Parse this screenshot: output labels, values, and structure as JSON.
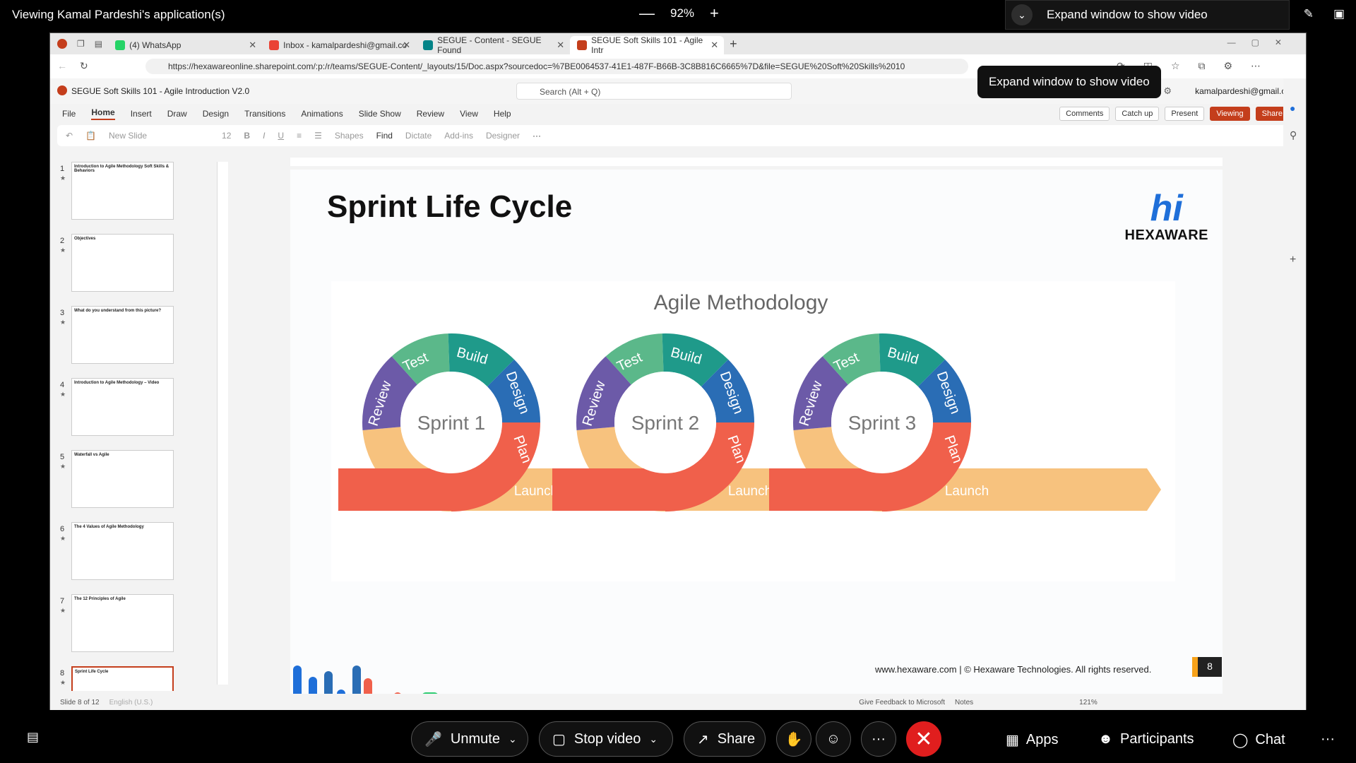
{
  "webex": {
    "viewing_title": "Viewing Kamal Pardeshi's application(s)",
    "zoom_minus": "—",
    "zoom_level": "92%",
    "zoom_plus": "+",
    "expand_label": "Expand window to show video",
    "bottom": {
      "unmute": "Unmute",
      "stop_video": "Stop video",
      "share": "Share",
      "more": "···",
      "apps": "Apps",
      "participants": "Participants",
      "chat": "Chat"
    }
  },
  "browser": {
    "tabs": [
      {
        "label": "(4) WhatsApp",
        "color": "#25d366"
      },
      {
        "label": "Inbox - kamalpardeshi@gmail.co",
        "color": "#ea4335"
      },
      {
        "label": "SEGUE - Content - SEGUE Found",
        "color": "#038387"
      },
      {
        "label": "SEGUE Soft Skills 101 - Agile Intr",
        "color": "#c43e1c"
      }
    ],
    "url": "https://hexawareonline.sharepoint.com/:p:/r/teams/SEGUE-Content/_layouts/15/Doc.aspx?sourcedoc=%7BE0064537-41E1-487F-B66B-3C8B816C6665%7D&file=SEGUE%20Soft%20Skills%2010",
    "tooltip": "Expand window to show video"
  },
  "ppt": {
    "doc_title": "SEGUE Soft Skills 101 - Agile Introduction V2.0",
    "search_placeholder": "Search (Alt + Q)",
    "user": "kamalpardeshi@gmail.com",
    "ribbon_tabs": [
      "File",
      "Home",
      "Insert",
      "Draw",
      "Design",
      "Transitions",
      "Animations",
      "Slide Show",
      "Review",
      "View",
      "Help"
    ],
    "buttons": {
      "comments": "Comments",
      "catch_up": "Catch up",
      "present": "Present",
      "viewing": "Viewing",
      "share": "Share"
    },
    "toolbar": {
      "new_slide": "New Slide",
      "font_size": "12",
      "shapes": "Shapes",
      "find": "Find",
      "dictate": "Dictate",
      "addins": "Add-ins",
      "designer": "Designer"
    },
    "thumbnails": [
      {
        "num": "1",
        "title": "Introduction to Agile Methodology Soft Skills & Behaviors"
      },
      {
        "num": "2",
        "title": "Objectives"
      },
      {
        "num": "3",
        "title": "What do you understand from this picture?"
      },
      {
        "num": "4",
        "title": "Introduction to Agile Methodology – Video"
      },
      {
        "num": "5",
        "title": "Waterfall vs Agile"
      },
      {
        "num": "6",
        "title": "The 4 Values of Agile Methodology"
      },
      {
        "num": "7",
        "title": "The 12 Principles of Agile"
      },
      {
        "num": "8",
        "title": "Sprint Life Cycle"
      }
    ],
    "status": {
      "slide_of": "Slide 8 of 12",
      "language": "English (U.S.)",
      "feedback": "Give Feedback to Microsoft",
      "notes": "Notes",
      "zoom": "121%"
    }
  },
  "slide": {
    "title": "Sprint Life Cycle",
    "logo_hi": "hi",
    "logo_text": "HEXAWARE",
    "diagram_title": "Agile Methodology",
    "sprints": [
      "Sprint 1",
      "Sprint 2",
      "Sprint 3"
    ],
    "segments": {
      "test": "Test",
      "build": "Build",
      "design": "Design",
      "plan": "Plan",
      "review": "Review",
      "launch": "Launch"
    },
    "footer": "www.hexaware.com  | © Hexaware Technologies. All rights reserved.",
    "page_number": "8"
  },
  "colors": {
    "test": "#5bb88a",
    "build": "#1f9a8a",
    "design": "#2a6db5",
    "plan": "#f0604b",
    "review": "#6c5aa8",
    "launch": "#f7c27e",
    "accent": "#c43e1c"
  }
}
